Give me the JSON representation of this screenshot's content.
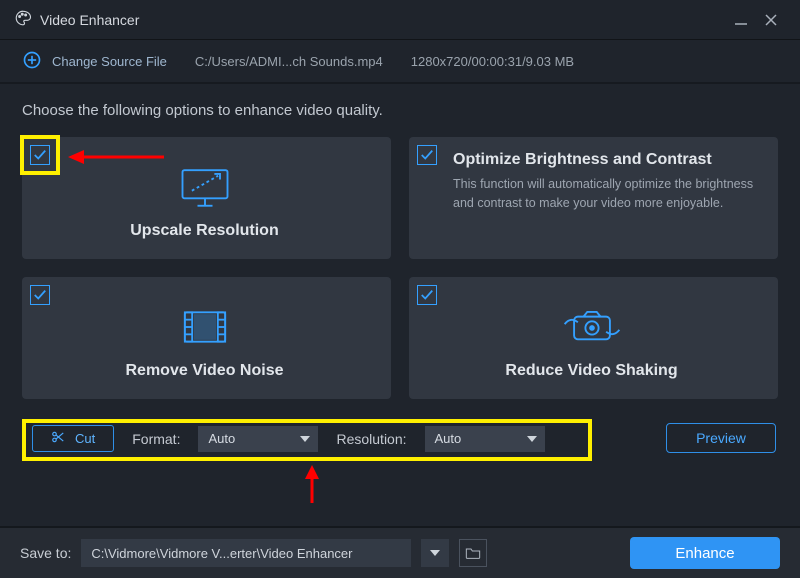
{
  "window": {
    "title": "Video Enhancer"
  },
  "filebar": {
    "change_label": "Change Source File",
    "path": "C:/Users/ADMI...ch Sounds.mp4",
    "info": "1280x720/00:00:31/9.03 MB"
  },
  "instruction": "Choose the following options to enhance video quality.",
  "cards": {
    "upscale": {
      "title": "Upscale Resolution"
    },
    "optimize": {
      "title": "Optimize Brightness and Contrast",
      "desc": "This function will automatically optimize the brightness and contrast to make your video more enjoyable."
    },
    "denoise": {
      "title": "Remove Video Noise"
    },
    "deshake": {
      "title": "Reduce Video Shaking"
    }
  },
  "controls": {
    "cut_label": "Cut",
    "format_label": "Format:",
    "format_value": "Auto",
    "resolution_label": "Resolution:",
    "resolution_value": "Auto",
    "preview_label": "Preview"
  },
  "bottom": {
    "save_label": "Save to:",
    "save_path": "C:\\Vidmore\\Vidmore V...erter\\Video Enhancer",
    "enhance_label": "Enhance"
  }
}
